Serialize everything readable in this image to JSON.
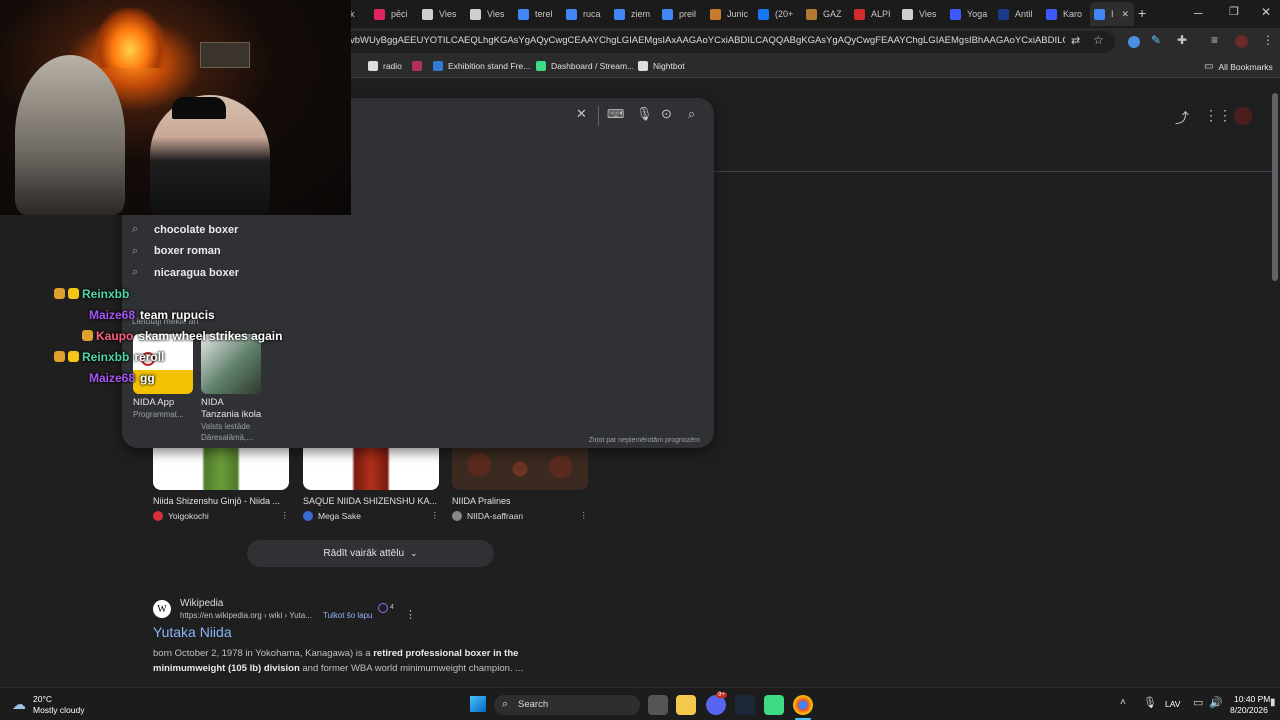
{
  "tabs": [
    {
      "label": "k",
      "color": "#444"
    },
    {
      "label": "pēci",
      "color": "#e0245e"
    },
    {
      "label": "Vies",
      "color": "#d0d0d0"
    },
    {
      "label": "Vies",
      "color": "#d0d0d0"
    },
    {
      "label": "terel",
      "color": "#4285f4"
    },
    {
      "label": "ruca",
      "color": "#4285f4"
    },
    {
      "label": "ziem",
      "color": "#4285f4"
    },
    {
      "label": "preil",
      "color": "#4285f4"
    },
    {
      "label": "Junic",
      "color": "#c97b2b"
    },
    {
      "label": "(20+",
      "color": "#1877f2"
    },
    {
      "label": "GAZ",
      "color": "#b07a30"
    },
    {
      "label": "ALPI",
      "color": "#d12b2b"
    },
    {
      "label": "Vies",
      "color": "#d0d0d0"
    },
    {
      "label": "Yoga",
      "color": "#3d5afe"
    },
    {
      "label": "Antil",
      "color": "#1a3a8a"
    },
    {
      "label": "Karo",
      "color": "#3d5afe"
    },
    {
      "label": "I",
      "color": "#4285f4"
    }
  ],
  "browser": {
    "new_tab": "+",
    "url": "vbWUyBggAEEUYOTILCAEQLhgKGAsYgAQyCwgCEAAYChgLGIAEMgsIAxAAGAoYCxiABDILCAQQABgKGAsYgAQyCwgFEAAYChgLGIAEMgsIBhAAGAoYCxiABDILCAcQLhgKGAsY...",
    "all_bookmarks": "All Bookmarks"
  },
  "bookmarks": [
    {
      "label": "radio",
      "color": "#ddd"
    },
    {
      "label": "",
      "color": "#b03060"
    },
    {
      "label": "Exhibition stand Fre...",
      "color": "#2e7bd6"
    },
    {
      "label": "Dashboard / Stream...",
      "color": "#3ddc84"
    },
    {
      "label": "Nightbot",
      "color": "#ddd"
    }
  ],
  "autocomplete": {
    "suggestions": [
      "chocolate boxer",
      "boxer roman",
      "nicaragua boxer"
    ],
    "related_heading": "Lietotāji meklē arī",
    "cards": [
      {
        "title": "NIDA App",
        "subtitle": "Programmat..."
      },
      {
        "title": "NIDA",
        "subtitle": "Tanzania ikola",
        "detail1": "Valsts iestāde",
        "detail2": "Dāresalāmā,..."
      }
    ],
    "report": "Ziņot par nepiemērotām prognozēm"
  },
  "images": [
    {
      "title": "Niida Shizenshu Ginjō - Niida ...",
      "source": "Yoigokochi",
      "src_color": "#d6313a"
    },
    {
      "title": "SAQUE NIIDA SHIZENSHU KA...",
      "source": "Mega Sake",
      "src_color": "#3a6ad4"
    },
    {
      "title": "NIIDA Pralines",
      "source": "NIIDA-saffraan",
      "src_color": "#888"
    }
  ],
  "show_more": "Rādīt vairāk attēlu",
  "result": {
    "site": "Wikipedia",
    "url": "https://en.wikipedia.org › wiki › Yuta...",
    "translate": "Tulkot šo lapu",
    "count": "4",
    "title": "Yutaka Niida",
    "snippet_1": "born October 2, 1978 in Yokohama, Kanagawa) is a",
    "snippet_bold_1": "retired professional boxer in the minimumweight",
    "snippet_bold_2": "(105 lb) division",
    "snippet_2": "and former WBA world minimumweight champion. ..."
  },
  "chat": [
    {
      "user": "Reinxbb",
      "color": "#4fd6a6",
      "message": ""
    },
    {
      "user": "Maize68",
      "color": "#a855f7",
      "message": "team rupucis"
    },
    {
      "user": "Kaupo",
      "color": "#ff5f7e",
      "message": "skam wheel strikes again"
    },
    {
      "user": "Reinxbb",
      "color": "#4fd6a6",
      "message": "reroll"
    },
    {
      "user": "Maize68",
      "color": "#a855f7",
      "message": "gg"
    }
  ],
  "weather": {
    "temp": "20°C",
    "desc": "Mostly cloudy"
  },
  "taskbar": {
    "search": "Search",
    "lang": "LAV",
    "time": "10:40 PM",
    "date": "8/20/2026",
    "notif": "9+"
  }
}
